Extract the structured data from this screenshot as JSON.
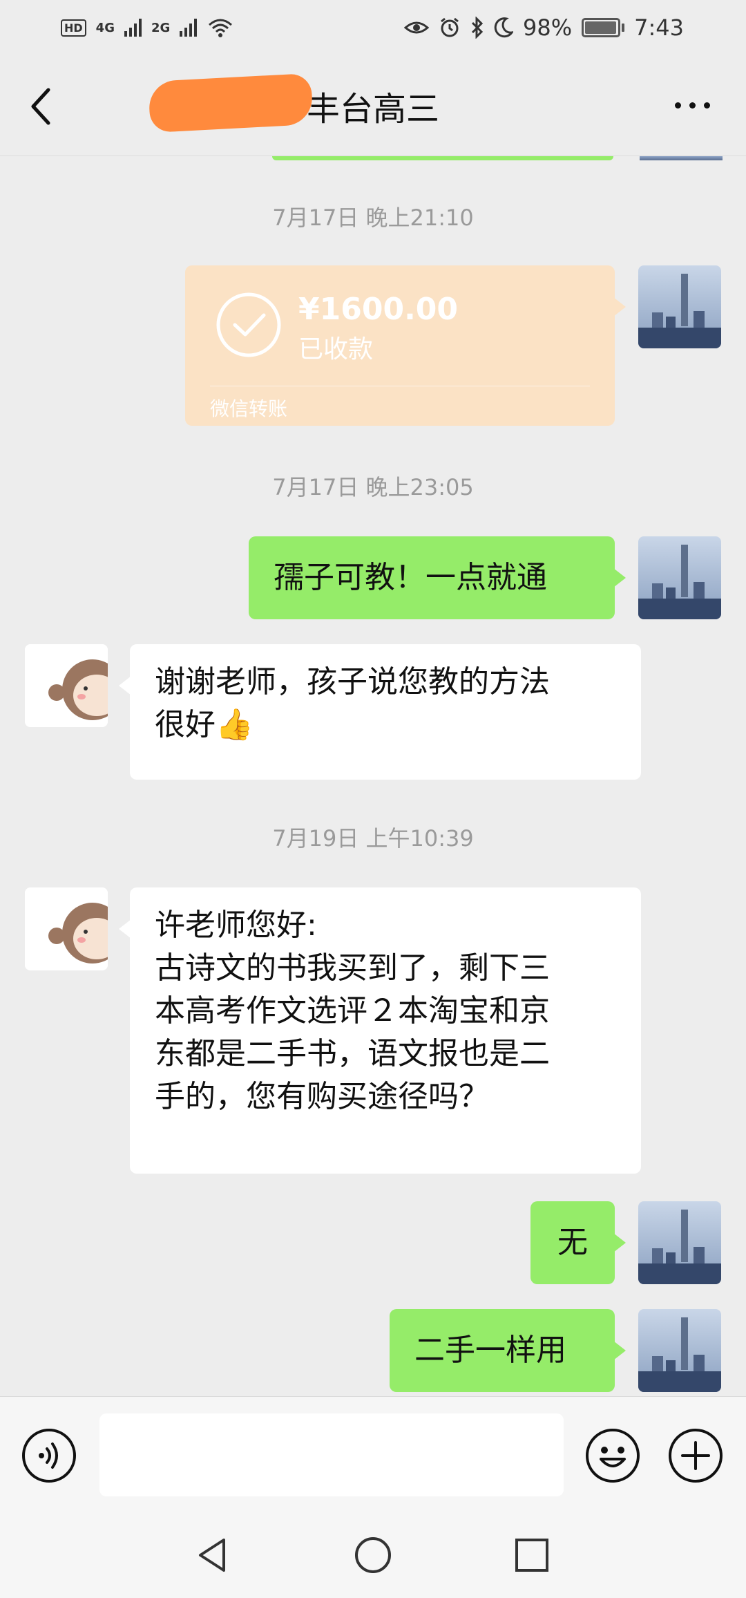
{
  "status_bar": {
    "network_left": "4G",
    "network_right": "2G",
    "battery": "98%",
    "battery_level": 0.98,
    "time": "7:43"
  },
  "header": {
    "title": "丰台高三"
  },
  "messages": [
    {
      "type": "time",
      "text": "7月17日 晚上21:10"
    },
    {
      "type": "transfer",
      "amount": "¥1600.00",
      "status": "已收款",
      "caption": "微信转账"
    },
    {
      "type": "time",
      "text": "7月17日 晚上23:05"
    },
    {
      "type": "text",
      "side": "right",
      "lines": [
        "孺子可教！一点就通"
      ]
    },
    {
      "type": "text",
      "side": "left",
      "lines": [
        "谢谢老师，孩子说您教的方法",
        "很好👍"
      ]
    },
    {
      "type": "time",
      "text": "7月19日 上午10:39"
    },
    {
      "type": "text",
      "side": "left",
      "lines": [
        "许老师您好:",
        "古诗文的书我买到了，剩下三",
        "本高考作文选评２本淘宝和京",
        "东都是二手书，语文报也是二",
        "手的，您有购买途径吗？"
      ]
    },
    {
      "type": "text",
      "side": "right",
      "lines": [
        "无"
      ]
    },
    {
      "type": "text",
      "side": "right",
      "lines": [
        "二手一样用"
      ]
    }
  ],
  "input_bar": {
    "voice_icon": "voice-icon",
    "emoji_icon": "emoji-icon",
    "plus_icon": "plus-icon",
    "text_value": ""
  },
  "nav_bar": {
    "icons": [
      "back-triangle-icon",
      "home-circle-icon",
      "recents-square-icon"
    ]
  },
  "colors": {
    "background": "#ededed",
    "green_bubble": "#95ec69",
    "white_bubble": "#ffffff",
    "transfer_card": "#fbe2c5",
    "timestamp": "#9a9a9a"
  }
}
